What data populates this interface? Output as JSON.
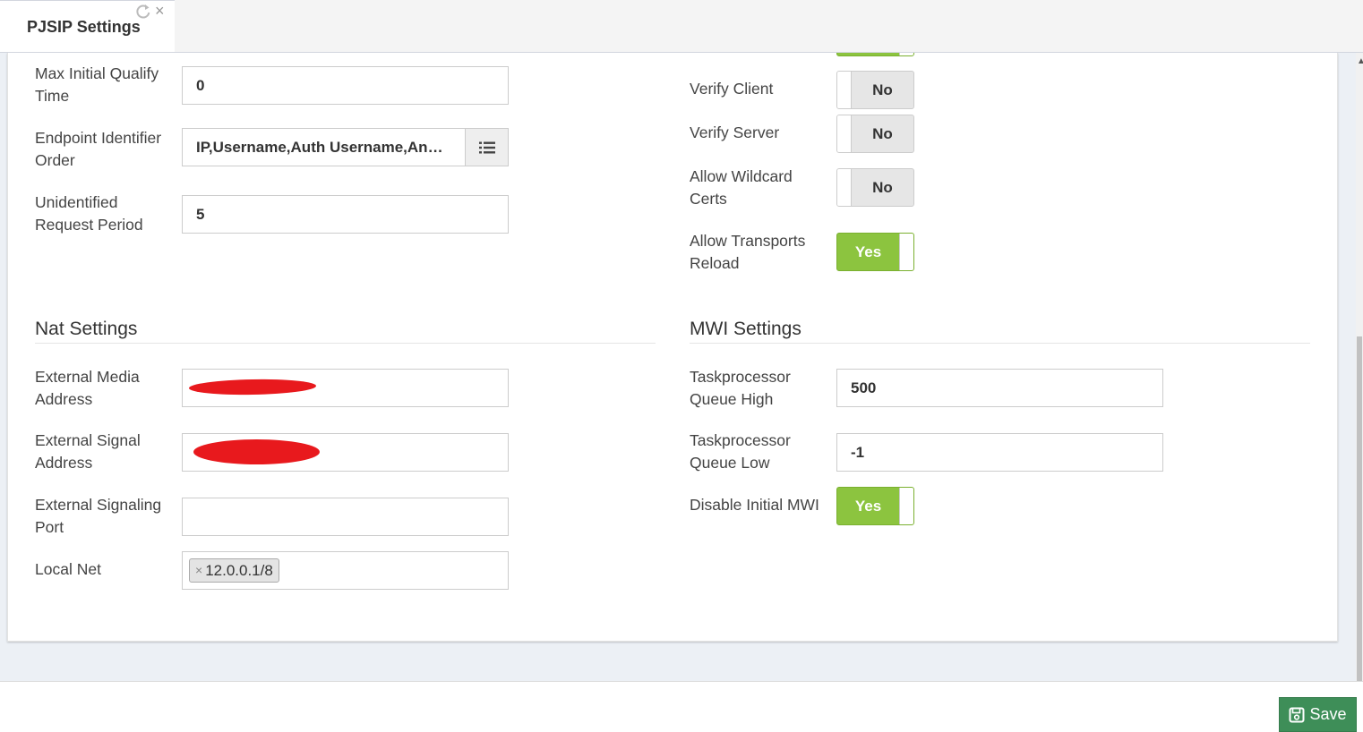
{
  "tab": {
    "title": "PJSIP Settings",
    "close": "×"
  },
  "left_fields": [
    {
      "label": "Max Initial Qualify Time",
      "value": "0"
    },
    {
      "label": "Endpoint Identifier Order",
      "value": "IP,Username,Auth Username,Anonymous"
    },
    {
      "label": "Unidentified Request Period",
      "value": "5"
    }
  ],
  "right_toggles": [
    {
      "label": "Verify Client",
      "state": "No"
    },
    {
      "label": "Verify Server",
      "state": "No"
    },
    {
      "label": "Allow Wildcard Certs",
      "state": "No"
    },
    {
      "label": "Allow Transports Reload",
      "state": "Yes"
    }
  ],
  "nat": {
    "title": "Nat Settings",
    "external_media_address": {
      "label": "External Media Address",
      "value": ""
    },
    "external_signal_address": {
      "label": "External Signal Address",
      "value": ""
    },
    "external_signaling_port": {
      "label": "External Signaling Port",
      "value": ""
    },
    "local_net": {
      "label": "Local Net",
      "chips": [
        "12.0.0.1/8"
      ],
      "chip_remove": "×"
    }
  },
  "mwi": {
    "title": "MWI Settings",
    "queue_high": {
      "label": "Taskprocessor Queue High",
      "value": "500"
    },
    "queue_low": {
      "label": "Taskprocessor Queue Low",
      "value": "-1"
    },
    "disable_initial": {
      "label": "Disable Initial MWI",
      "state": "Yes"
    }
  },
  "footer": {
    "save_label": "Save"
  },
  "colors": {
    "toggle_on": "#8cc43f",
    "save_button": "#3e8e58",
    "redaction": "#e8191d"
  },
  "icons": {
    "refresh": "refresh-icon",
    "list": "list-icon",
    "save": "floppy-disk-icon",
    "close": "close-icon"
  }
}
